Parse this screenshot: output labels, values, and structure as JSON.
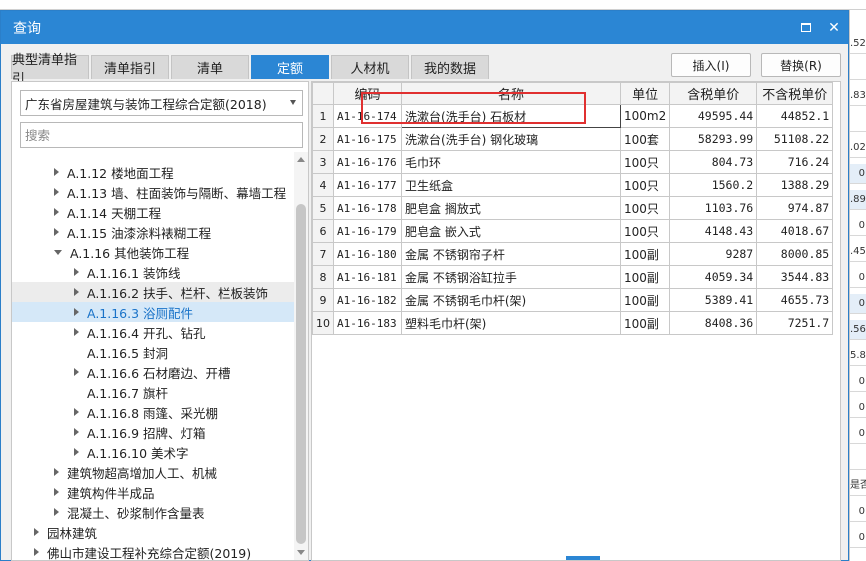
{
  "dialog": {
    "title": "查询"
  },
  "tabs": [
    {
      "label": "典型清单指引"
    },
    {
      "label": "清单指引"
    },
    {
      "label": "清单"
    },
    {
      "label": "定额",
      "active": true
    },
    {
      "label": "人材机"
    },
    {
      "label": "我的数据"
    }
  ],
  "actions": {
    "insert_label": "插入(I)",
    "replace_label": "替换(R)"
  },
  "left": {
    "library_selected": "广东省房屋建筑与装饰工程综合定额(2018)",
    "search_placeholder": "搜索",
    "tree": [
      {
        "label": "A.1.12 楼地面工程",
        "level": 2,
        "arrow": "right"
      },
      {
        "label": "A.1.13 墙、柱面装饰与隔断、幕墙工程",
        "level": 2,
        "arrow": "right"
      },
      {
        "label": "A.1.14 天棚工程",
        "level": 2,
        "arrow": "right"
      },
      {
        "label": "A.1.15 油漆涂料裱糊工程",
        "level": 2,
        "arrow": "right"
      },
      {
        "label": "A.1.16 其他装饰工程",
        "level": 2,
        "arrow": "down"
      },
      {
        "label": "A.1.16.1 装饰线",
        "level": 3,
        "arrow": "right"
      },
      {
        "label": "A.1.16.2 扶手、栏杆、栏板装饰",
        "level": 3,
        "arrow": "right",
        "state": "hover"
      },
      {
        "label": "A.1.16.3 浴厕配件",
        "level": 3,
        "arrow": "right",
        "state": "selected"
      },
      {
        "label": "A.1.16.4 开孔、钻孔",
        "level": 3,
        "arrow": "right"
      },
      {
        "label": "A.1.16.5 封洞",
        "level": 3,
        "arrow": "none"
      },
      {
        "label": "A.1.16.6 石材磨边、开槽",
        "level": 3,
        "arrow": "right"
      },
      {
        "label": "A.1.16.7 旗杆",
        "level": 3,
        "arrow": "none"
      },
      {
        "label": "A.1.16.8 雨篷、采光棚",
        "level": 3,
        "arrow": "right"
      },
      {
        "label": "A.1.16.9 招牌、灯箱",
        "level": 3,
        "arrow": "right"
      },
      {
        "label": "A.1.16.10 美术字",
        "level": 3,
        "arrow": "right"
      },
      {
        "label": "建筑物超高增加人工、机械",
        "level": 2,
        "arrow": "right"
      },
      {
        "label": "建筑构件半成品",
        "level": 2,
        "arrow": "right"
      },
      {
        "label": "混凝土、砂浆制作含量表",
        "level": 2,
        "arrow": "right"
      },
      {
        "label": "园林建筑",
        "level": 1,
        "arrow": "right"
      },
      {
        "label": "佛山市建设工程补充综合定额(2019)",
        "level": 1,
        "arrow": "right"
      }
    ]
  },
  "grid": {
    "columns": [
      "编码",
      "名称",
      "单位",
      "含税单价",
      "不含税单价"
    ],
    "rows": [
      {
        "n": "1",
        "code": "A1-16-174",
        "name": "洗漱台(洗手台) 石板材",
        "unit": "100m2",
        "price_tax": "49595.44",
        "price_notax": "44852.1"
      },
      {
        "n": "2",
        "code": "A1-16-175",
        "name": "洗漱台(洗手台) 钢化玻璃",
        "unit": "100套",
        "price_tax": "58293.99",
        "price_notax": "51108.22"
      },
      {
        "n": "3",
        "code": "A1-16-176",
        "name": "毛巾环",
        "unit": "100只",
        "price_tax": "804.73",
        "price_notax": "716.24"
      },
      {
        "n": "4",
        "code": "A1-16-177",
        "name": "卫生纸盒",
        "unit": "100只",
        "price_tax": "1560.2",
        "price_notax": "1388.29"
      },
      {
        "n": "5",
        "code": "A1-16-178",
        "name": "肥皂盒 搁放式",
        "unit": "100只",
        "price_tax": "1103.76",
        "price_notax": "974.87"
      },
      {
        "n": "6",
        "code": "A1-16-179",
        "name": "肥皂盒 嵌入式",
        "unit": "100只",
        "price_tax": "4148.43",
        "price_notax": "4018.67"
      },
      {
        "n": "7",
        "code": "A1-16-180",
        "name": "金属 不锈钢帘子杆",
        "unit": "100副",
        "price_tax": "9287",
        "price_notax": "8000.85"
      },
      {
        "n": "8",
        "code": "A1-16-181",
        "name": "金属 不锈钢浴缸拉手",
        "unit": "100副",
        "price_tax": "4059.34",
        "price_notax": "3544.83"
      },
      {
        "n": "9",
        "code": "A1-16-182",
        "name": "金属 不锈钢毛巾杆(架)",
        "unit": "100副",
        "price_tax": "5389.41",
        "price_notax": "4655.73"
      },
      {
        "n": "10",
        "code": "A1-16-183",
        "name": "塑料毛巾杆(架)",
        "unit": "100副",
        "price_tax": "8408.36",
        "price_notax": "7251.7"
      }
    ]
  },
  "background_sheet": {
    "right_cells": [
      ".52",
      "",
      ".83",
      "",
      ".02",
      "0",
      ".89",
      "0",
      ".45",
      "0",
      "0",
      ".56",
      "5.8",
      "0",
      "0",
      "0",
      "",
      "是否",
      "0",
      "0"
    ]
  },
  "colors": {
    "accent": "#2b86d4",
    "selected_bg": "#d5e8f8",
    "highlight_box": "#e03030"
  }
}
